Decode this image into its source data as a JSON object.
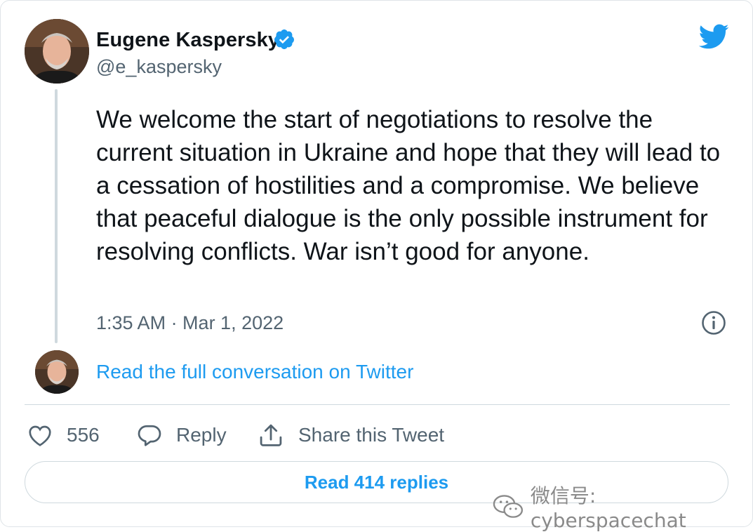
{
  "author": {
    "name": "Eugene Kaspersky",
    "handle": "@e_kaspersky",
    "avatar_icon": "avatar-photo",
    "verified_icon": "verified-badge-icon"
  },
  "tweet": {
    "text": "We welcome the start of negotiations to resolve the current situation in Ukraine and hope that they will lead to a cessation of hostilities and a compromise. We believe that peaceful dialogue is the only possible instrument for resolving conflicts. War isn’t good for anyone.",
    "timestamp": "1:35 AM · Mar 1, 2022"
  },
  "conversation": {
    "link_label": "Read the full conversation on Twitter"
  },
  "actions": {
    "like_count": "556",
    "reply_label": "Reply",
    "share_label": "Share this Tweet"
  },
  "read_replies_label": "Read 414 replies",
  "watermark": "微信号: cyberspacechat",
  "colors": {
    "accent": "#1d9bf0",
    "text": "#0f1419",
    "secondary": "#536471",
    "border": "#cfd9de"
  }
}
